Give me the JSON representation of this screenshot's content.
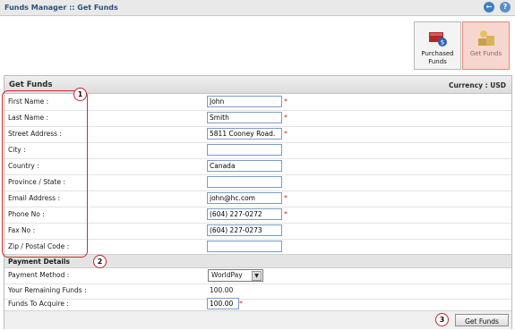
{
  "window": {
    "title": "Funds Manager :: Get Funds"
  },
  "toolbar": {
    "tiles": [
      {
        "label_line1": "Purchased",
        "label_line2": "Funds",
        "active": false
      },
      {
        "label": "Get Funds",
        "active": true
      }
    ]
  },
  "panel": {
    "title": "Get Funds",
    "currency": "Currency : USD"
  },
  "form": {
    "fields": [
      {
        "label": "First Name :",
        "value": "John",
        "required": true
      },
      {
        "label": "Last Name :",
        "value": "Smith",
        "required": true
      },
      {
        "label": "Street Address :",
        "value": "5811 Cooney Road.",
        "required": true
      },
      {
        "label": "City :",
        "value": "",
        "required": false
      },
      {
        "label": "Country :",
        "value": "Canada",
        "required": false
      },
      {
        "label": "Province / State :",
        "value": "",
        "required": false
      },
      {
        "label": "Email Address :",
        "value": "john@hc.com",
        "required": true
      },
      {
        "label": "Phone No :",
        "value": "(604) 227-0272",
        "required": true
      },
      {
        "label": "Fax No :",
        "value": "(604) 227-0273",
        "required": false
      },
      {
        "label": "Zip / Postal Code :",
        "value": "",
        "required": false
      }
    ],
    "required_marker": "*"
  },
  "payment": {
    "section_title": "Payment Details",
    "method_label": "Payment Method :",
    "method_value": "WorldPay",
    "remaining_label": "Your Remaining Funds :",
    "remaining_value": "100.00",
    "acquire_label": "Funds To Acquire :",
    "acquire_value": "100.00"
  },
  "actions": {
    "submit_label": "Get Funds"
  },
  "callouts": [
    "1",
    "2",
    "3"
  ],
  "colors": {
    "accent": "#d22c2c",
    "input_border": "#7a9cc6",
    "active_tile": "#f7d6cf"
  },
  "icons": {
    "back": "back-arrow-icon",
    "help": "help-icon"
  }
}
